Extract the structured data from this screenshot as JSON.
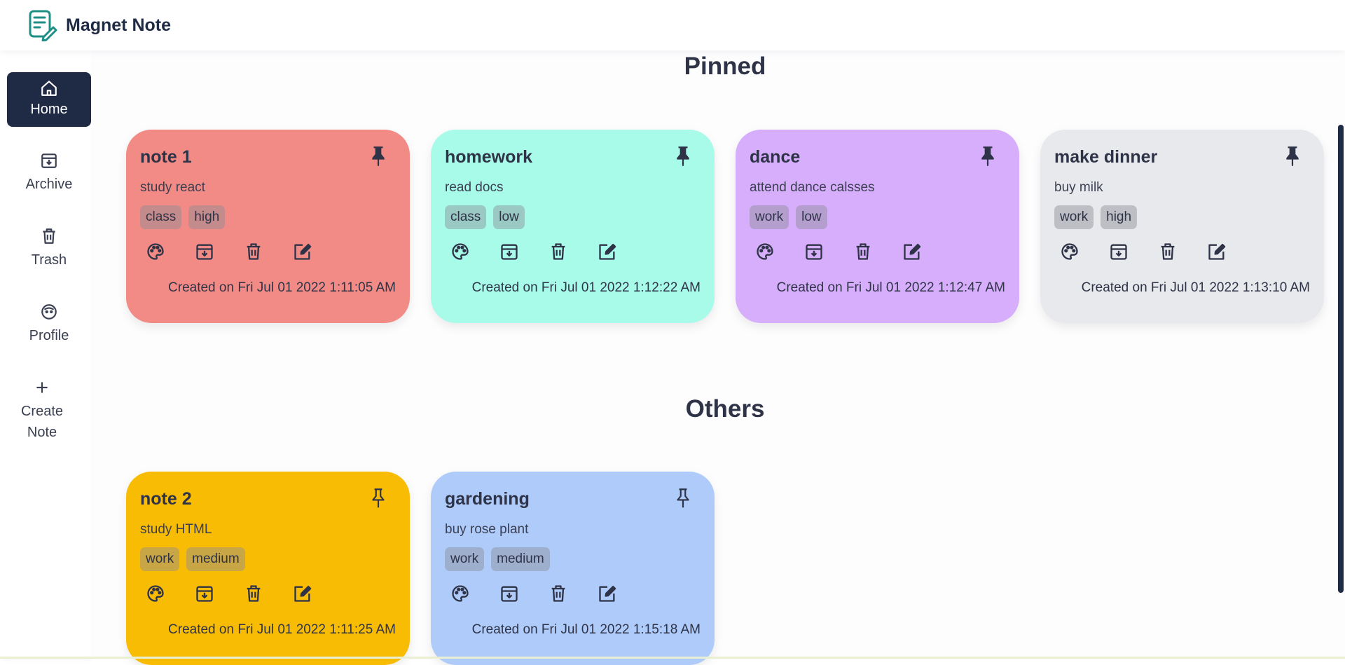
{
  "app": {
    "title": "Magnet Note"
  },
  "sidebar": {
    "items": [
      {
        "label": "Home",
        "icon": "home-icon",
        "active": true
      },
      {
        "label": "Archive",
        "icon": "archive-icon"
      },
      {
        "label": "Trash",
        "icon": "trash-icon"
      },
      {
        "label": "Profile",
        "icon": "profile-icon"
      },
      {
        "label": "Create Note",
        "icon": "plus-icon"
      }
    ]
  },
  "sections": {
    "pinned": "Pinned",
    "others": "Others"
  },
  "pinned_notes": [
    {
      "title": "note 1",
      "body": "study react",
      "tags": [
        "class",
        "high"
      ],
      "created": "Created on Fri Jul 01 2022 1:11:05 AM",
      "color": "#f28b85",
      "pinned": true
    },
    {
      "title": "homework",
      "body": "read docs",
      "tags": [
        "class",
        "low"
      ],
      "created": "Created on Fri Jul 01 2022 1:12:22 AM",
      "color": "#a7fbe8",
      "pinned": true
    },
    {
      "title": "dance",
      "body": "attend dance calsses",
      "tags": [
        "work",
        "low"
      ],
      "created": "Created on Fri Jul 01 2022 1:12:47 AM",
      "color": "#d6aefb",
      "pinned": true
    },
    {
      "title": "make dinner",
      "body": "buy milk",
      "tags": [
        "work",
        "high"
      ],
      "created": "Created on Fri Jul 01 2022 1:13:10 AM",
      "color": "#e8e9ec",
      "pinned": true
    }
  ],
  "other_notes": [
    {
      "title": "note 2",
      "body": "study HTML",
      "tags": [
        "work",
        "medium"
      ],
      "created": "Created on Fri Jul 01 2022 1:11:25 AM",
      "color": "#f9bc05",
      "pinned": false
    },
    {
      "title": "gardening",
      "body": "buy rose plant",
      "tags": [
        "work",
        "medium"
      ],
      "created": "Created on Fri Jul 01 2022 1:15:18 AM",
      "color": "#aecbfa",
      "pinned": false
    }
  ],
  "card_actions": [
    "palette-icon",
    "archive-icon",
    "trash-icon",
    "edit-icon"
  ]
}
